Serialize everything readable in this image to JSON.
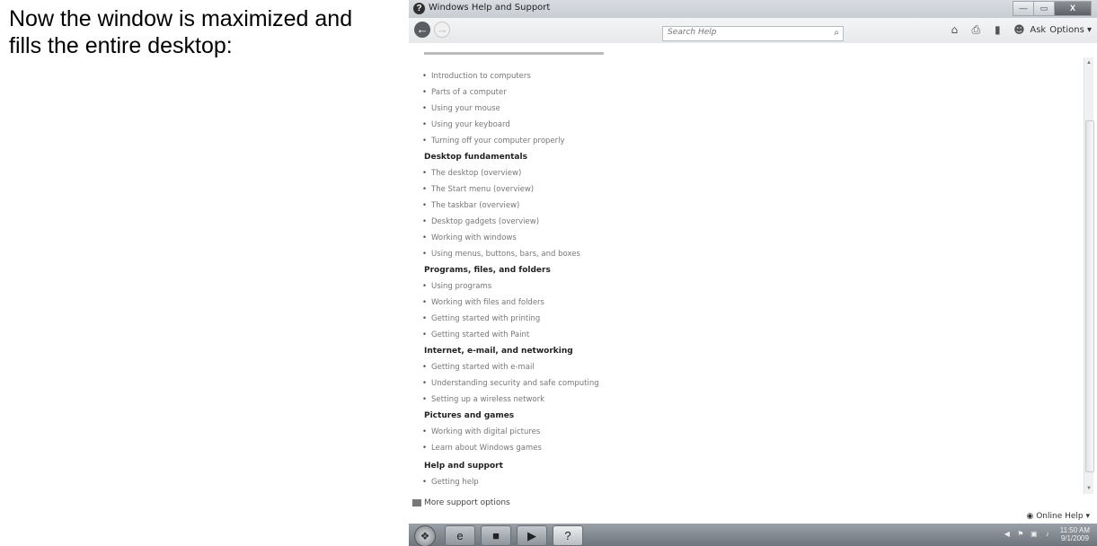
{
  "caption": "Now the window is maximized and fills the entire desktop:",
  "window": {
    "title": "Windows Help and Support",
    "buttons": {
      "minimize": "—",
      "maximize": "▭",
      "close": "X"
    }
  },
  "toolbar": {
    "search_placeholder": "Search Help",
    "ask_label": "Ask",
    "options_label": "Options ▾"
  },
  "content": {
    "section1_items": [
      "Introduction to computers",
      "Parts of a computer",
      "Using your mouse",
      "Using your keyboard",
      "Turning off your computer properly"
    ],
    "section2": {
      "heading": "Desktop fundamentals",
      "items": [
        "The desktop (overview)",
        "The Start menu (overview)",
        "The taskbar (overview)",
        "Desktop gadgets (overview)",
        "Working with windows",
        "Using menus, buttons, bars, and boxes"
      ]
    },
    "section3": {
      "heading": "Programs, files, and folders",
      "items": [
        "Using programs",
        "Working with files and folders",
        "Getting started with printing",
        "Getting started with Paint"
      ]
    },
    "section4": {
      "heading": "Internet, e-mail, and networking",
      "items": [
        "Getting started with e-mail",
        "Understanding security and safe computing",
        "Setting up a wireless network"
      ]
    },
    "section5": {
      "heading": "Pictures and games",
      "items": [
        "Working with digital pictures",
        "Learn about Windows games"
      ]
    },
    "section6": {
      "heading": "Help and support",
      "items": [
        "Getting help"
      ]
    }
  },
  "footer": {
    "more_support": "More support options",
    "online_help": "Online Help ▾"
  },
  "taskbar": {
    "clock_time": "11:50 AM",
    "clock_date": "9/1/2009"
  }
}
